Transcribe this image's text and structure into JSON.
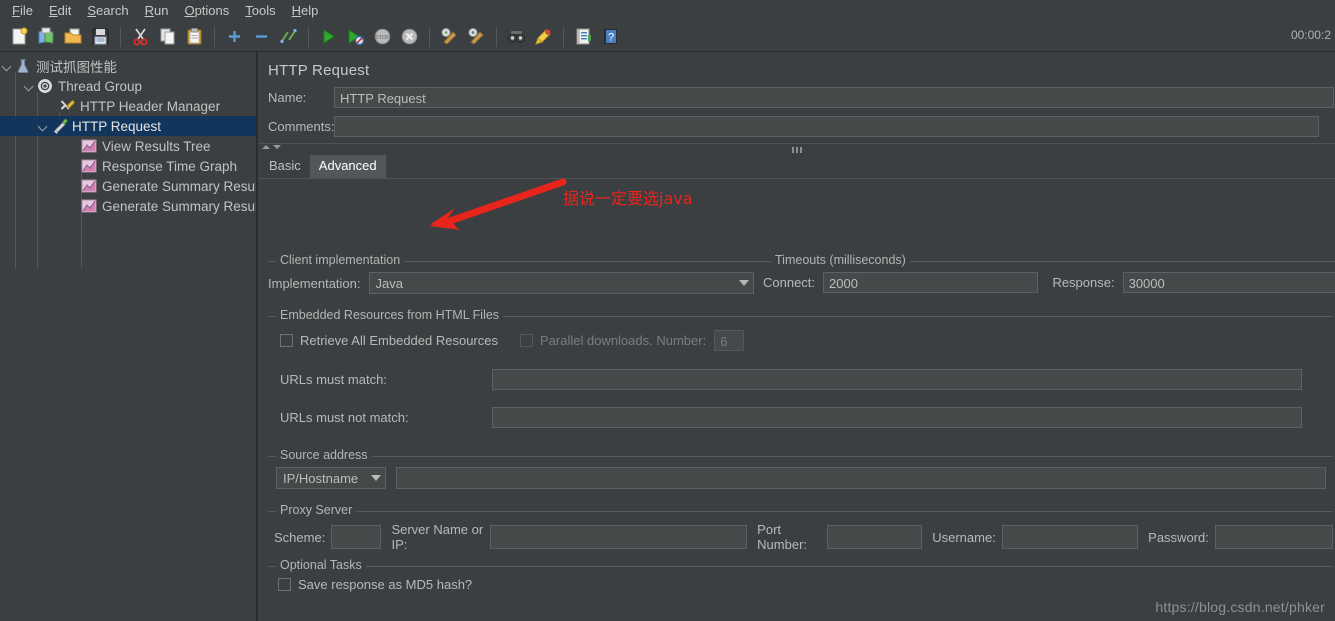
{
  "window": {
    "timer": "00:00:2"
  },
  "menubar": {
    "items": [
      {
        "label": "File",
        "mnemonic": "F"
      },
      {
        "label": "Edit",
        "mnemonic": "E"
      },
      {
        "label": "Search",
        "mnemonic": "S"
      },
      {
        "label": "Run",
        "mnemonic": "R"
      },
      {
        "label": "Options",
        "mnemonic": "O"
      },
      {
        "label": "Tools",
        "mnemonic": "T"
      },
      {
        "label": "Help",
        "mnemonic": "H"
      }
    ]
  },
  "toolbar": {
    "buttons": [
      {
        "name": "new-icon",
        "title": "New"
      },
      {
        "name": "templates-icon",
        "title": "Templates"
      },
      {
        "name": "open-icon",
        "title": "Open"
      },
      {
        "name": "save-icon",
        "title": "Save Test Plan"
      },
      {
        "name": "cut-icon",
        "title": "Cut"
      },
      {
        "name": "copy-icon",
        "title": "Copy"
      },
      {
        "name": "paste-icon",
        "title": "Paste"
      },
      {
        "name": "expand-all-icon",
        "title": "Expand All"
      },
      {
        "name": "collapse-all-icon",
        "title": "Collapse All"
      },
      {
        "name": "toggle-icon",
        "title": "Toggle"
      },
      {
        "name": "start-icon",
        "title": "Start"
      },
      {
        "name": "start-no-pauses-icon",
        "title": "Start no pauses"
      },
      {
        "name": "stop-icon",
        "title": "Stop"
      },
      {
        "name": "shutdown-icon",
        "title": "Shutdown"
      },
      {
        "name": "clear-icon",
        "title": "Clear"
      },
      {
        "name": "clear-all-icon",
        "title": "Clear All"
      },
      {
        "name": "search-icon",
        "title": "Search"
      },
      {
        "name": "reset-search-icon",
        "title": "Reset Search"
      },
      {
        "name": "function-helper-icon",
        "title": "Function Helper Dialog"
      },
      {
        "name": "help-icon",
        "title": "Help"
      }
    ]
  },
  "tree": {
    "nodes": [
      {
        "label": "测试抓图性能",
        "icon": "test-plan-icon",
        "depth": 0,
        "expanded": true,
        "selected": false
      },
      {
        "label": "Thread Group",
        "icon": "thread-group-icon",
        "depth": 1,
        "expanded": true,
        "selected": false
      },
      {
        "label": "HTTP Header Manager",
        "icon": "header-manager-icon",
        "depth": 2,
        "expanded": false,
        "selected": false
      },
      {
        "label": "HTTP Request",
        "icon": "http-request-icon",
        "depth": 2,
        "expanded": true,
        "selected": true
      },
      {
        "label": "View Results Tree",
        "icon": "listener-icon",
        "depth": 3,
        "expanded": false,
        "selected": false
      },
      {
        "label": "Response Time Graph",
        "icon": "listener-icon",
        "depth": 3,
        "expanded": false,
        "selected": false
      },
      {
        "label": "Generate Summary Results",
        "icon": "listener-icon",
        "depth": 3,
        "expanded": false,
        "selected": false
      },
      {
        "label": "Generate Summary Results",
        "icon": "listener-icon",
        "depth": 3,
        "expanded": false,
        "selected": false
      }
    ]
  },
  "panel": {
    "title": "HTTP Request",
    "name_label": "Name:",
    "name_value": "HTTP Request",
    "comments_label": "Comments:",
    "comments_value": "",
    "tabs": [
      {
        "label": "Basic",
        "active": false
      },
      {
        "label": "Advanced",
        "active": true
      }
    ]
  },
  "client_implementation": {
    "group_title": "Client implementation",
    "implementation_label": "Implementation:",
    "implementation_value": "Java"
  },
  "timeouts": {
    "group_title": "Timeouts (milliseconds)",
    "connect_label": "Connect:",
    "connect_value": "2000",
    "response_label": "Response:",
    "response_value": "30000"
  },
  "embedded_resources": {
    "group_title": "Embedded Resources from HTML Files",
    "retrieve_label": "Retrieve All Embedded Resources",
    "retrieve_checked": false,
    "parallel_label": "Parallel downloads. Number:",
    "parallel_checked": false,
    "parallel_enabled": false,
    "parallel_value": "6",
    "urls_match_label": "URLs must match:",
    "urls_match_value": "",
    "urls_not_match_label": "URLs must not match:",
    "urls_not_match_value": ""
  },
  "source_address": {
    "group_title": "Source address",
    "type_value": "IP/Hostname",
    "address_value": ""
  },
  "proxy_server": {
    "group_title": "Proxy Server",
    "scheme_label": "Scheme:",
    "scheme_value": "",
    "server_label": "Server Name or IP:",
    "server_value": "",
    "port_label": "Port Number:",
    "port_value": "",
    "username_label": "Username:",
    "username_value": "",
    "password_label": "Password:",
    "password_value": ""
  },
  "optional_tasks": {
    "group_title": "Optional Tasks",
    "md5_label": "Save response as MD5 hash?",
    "md5_checked": false
  },
  "annotation": {
    "text": "据说一定要选java",
    "color": "#e8251b"
  },
  "watermark": {
    "text": "https://blog.csdn.net/phker"
  },
  "colors": {
    "background": "#3c3f41",
    "field_background": "#45494a",
    "selection": "#12355b",
    "border": "#5c6164",
    "text": "#bbbbbb",
    "annotation_red": "#e8251b"
  }
}
